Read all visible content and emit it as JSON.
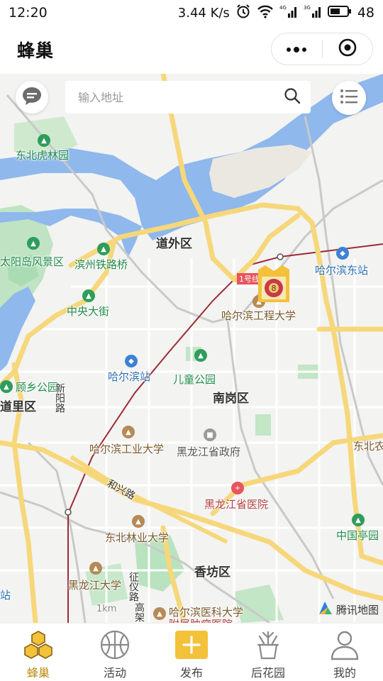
{
  "status_bar": {
    "time": "12:20",
    "speed": "3.44 K/s",
    "battery": "48",
    "icons": [
      "alarm-icon",
      "wifi-icon",
      "signal-4g-icon",
      "signal-3g-icon",
      "battery-icon"
    ]
  },
  "titlebar": {
    "title": "蜂巢",
    "more_icon": "more-dots-icon",
    "close_icon": "target-close-icon"
  },
  "map": {
    "search": {
      "placeholder": "输入地址"
    },
    "labels": {
      "dongbei_hulinyuan": "东北虎林园",
      "taiyangdao": "太阳岛风景区",
      "binzhou_bridge": "滨州铁路桥",
      "daowai": "道外区",
      "harbin_east": "哈尔滨东站",
      "line1": "1号线",
      "hit_eng": "哈尔滨工程大学",
      "zhongyang_street": "中央大街",
      "harbin_station": "哈尔滨站",
      "children_park": "儿童公园",
      "guxiang_park": "顾乡公园",
      "daoli": "道里区",
      "xinyang_road": "新阳路",
      "nangang": "南岗区",
      "hit": "哈尔滨工业大学",
      "hlj_gov": "黑龙江省政府",
      "dongbei_edge": "东北农",
      "hexing_road": "和兴路",
      "hlj_hospital": "黑龙江省医院",
      "nefu": "东北林业大学",
      "zhongguo_pavilion": "中国亭园",
      "xiangfang": "香坊区",
      "hlj_univ": "黑龙江大学",
      "zhengyi_road": "征仪路",
      "gaojia": "高架",
      "hmu": "哈尔滨医科大学",
      "hmu_hospital": "附属肿瘤医院",
      "scale": "1km",
      "left_edge": "站"
    },
    "brand": "腾讯地图"
  },
  "tabbar": {
    "items": [
      {
        "label": "蜂巢",
        "icon": "honeycomb-icon",
        "active": true
      },
      {
        "label": "活动",
        "icon": "basketball-icon",
        "active": false
      },
      {
        "label": "发布",
        "icon": "plus-icon",
        "active": false
      },
      {
        "label": "后花园",
        "icon": "potted-plant-icon",
        "active": false
      },
      {
        "label": "我的",
        "icon": "user-icon",
        "active": false
      }
    ]
  },
  "colors": {
    "accent": "#f3c13a",
    "active_tab": "#b98a11",
    "water": "#8fb8ec",
    "park": "#a9dcb2",
    "road_major": "#f6d77a"
  }
}
